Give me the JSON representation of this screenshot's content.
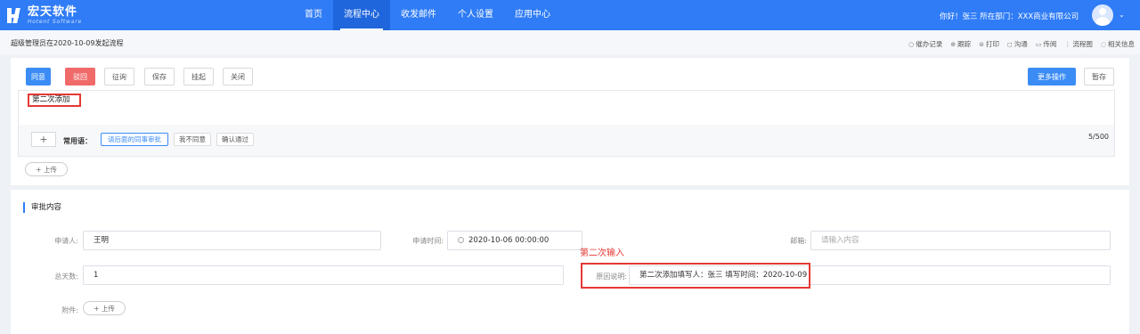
{
  "brand": {
    "name": "宏天软件",
    "tagline": "Hotent Software"
  },
  "nav": {
    "items": [
      {
        "label": "首页"
      },
      {
        "label": "流程中心",
        "active": true
      },
      {
        "label": "收发邮件"
      },
      {
        "label": "个人设置"
      },
      {
        "label": "应用中心"
      }
    ]
  },
  "user": {
    "greeting": "你好！张三 所在部门：XXX商业有限公司"
  },
  "subbar": {
    "title": "超级管理员在2020-10-09发起流程",
    "tools": [
      {
        "label": "催办记录",
        "icon": "circle-icon"
      },
      {
        "label": "跟踪",
        "icon": "target-icon"
      },
      {
        "label": "打印",
        "icon": "print-icon"
      },
      {
        "label": "沟通",
        "icon": "chat-icon"
      },
      {
        "label": "传阅",
        "icon": "folder-icon"
      },
      {
        "label": "流程图",
        "icon": "flow-icon"
      },
      {
        "label": "相关信息",
        "icon": "info-icon"
      }
    ]
  },
  "actions": {
    "agree": "同意",
    "reject": "驳回",
    "consult": "征询",
    "save": "保存",
    "suspend": "挂起",
    "close": "关闭",
    "more": "更多操作",
    "draft": "暂存"
  },
  "opinion": {
    "text": "第二次添加",
    "phrases_label": "常用语：",
    "phrases": [
      {
        "label": "请后面的同事审批",
        "selected": true
      },
      {
        "label": "我不同意",
        "selected": false
      },
      {
        "label": "确认通过",
        "selected": false
      }
    ],
    "counter": "5/500",
    "plus": "+"
  },
  "upload_label": "+ 上传",
  "approval": {
    "section_title": "审批内容",
    "applicant_label": "申请人:",
    "applicant_value": "王明",
    "apply_time_label": "申请时间:",
    "apply_time_value": "2020-10-06 00:00:00",
    "email_label": "邮箱:",
    "email_placeholder": "请输入内容",
    "days_label": "总天数:",
    "days_value": "1",
    "reason_label": "原因说明:",
    "reason_value": "第二次添加填写人：张三 填写时间：2020-10-09",
    "attachment_label": "附件:"
  },
  "annotation": "第二次输入",
  "colors": {
    "primary": "#2f7cf6",
    "danger": "#f06a6a",
    "highlight": "#e53935"
  }
}
